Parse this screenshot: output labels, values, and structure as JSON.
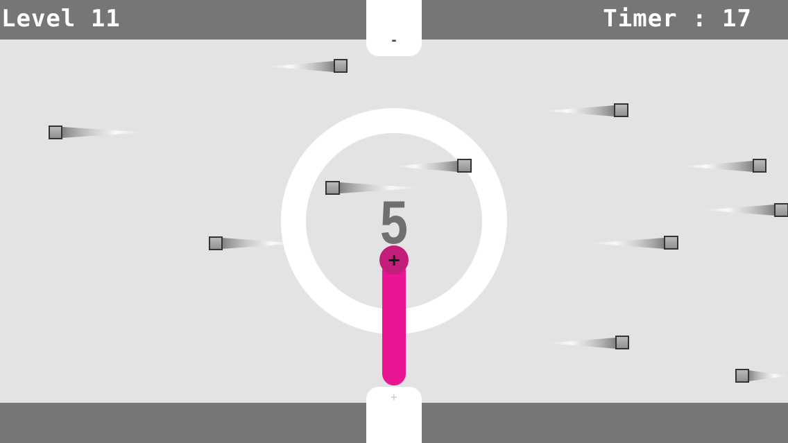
{
  "hud": {
    "level_label": "Level 11",
    "timer_label": "Timer : 17"
  },
  "gates": {
    "top_symbol": "-",
    "bottom_symbol": "+"
  },
  "center": {
    "countdown": "5"
  },
  "player": {
    "head_symbol": "+",
    "color": "#ea1593",
    "head_color": "#c41d7b"
  },
  "colors": {
    "background": "#e3e3e4",
    "bars": "#767676",
    "ring": "#ffffff",
    "bullet": "#555555"
  },
  "icons": [
    "bullet-icon",
    "snake-head-icon"
  ]
}
